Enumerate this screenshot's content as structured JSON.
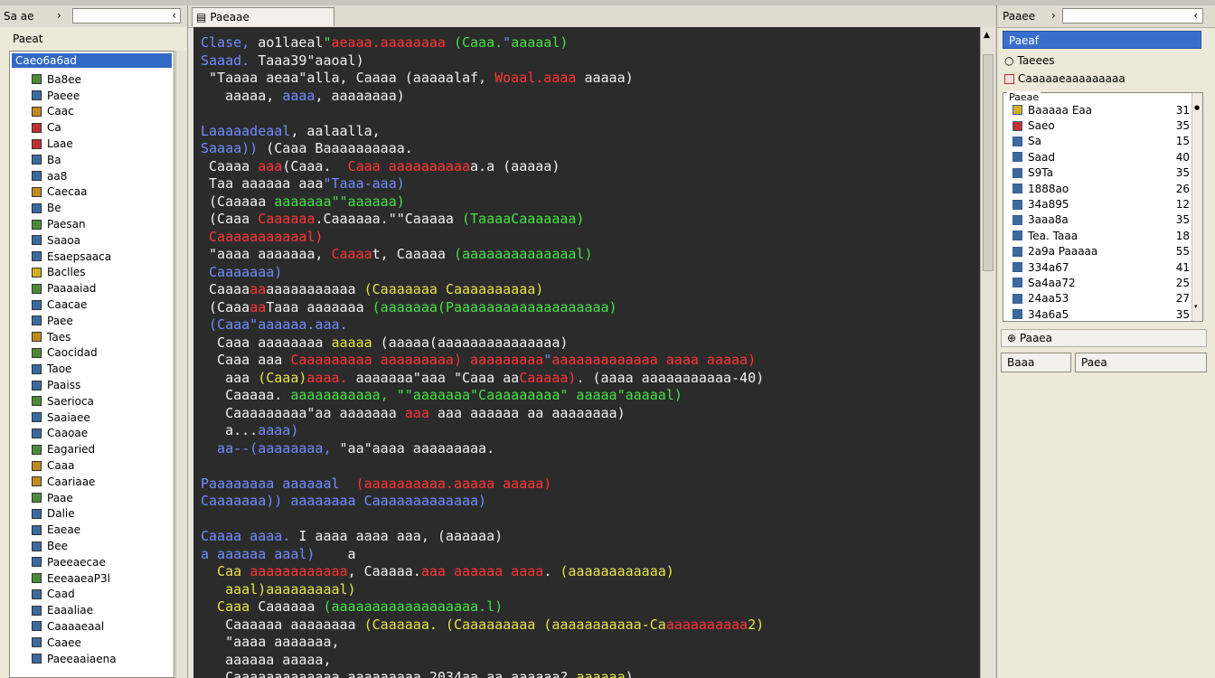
{
  "left": {
    "toolbar_label": "Sa ae",
    "toolbar_chev": "›",
    "toolbar_btn": "‹",
    "header": "Paeat",
    "root": "Caeo6a6ad",
    "items": [
      {
        "label": "Ba8ee",
        "color": "#4a8a3a"
      },
      {
        "label": "Paeee",
        "color": "#3a6aa0"
      },
      {
        "label": "Caac",
        "color": "#c08a20"
      },
      {
        "label": "Ca",
        "color": "#c03030"
      },
      {
        "label": "Laae",
        "color": "#c03030"
      },
      {
        "label": "Ba",
        "color": "#3a6aa0"
      },
      {
        "label": "aa8",
        "color": "#3a6aa0"
      },
      {
        "label": "Caecaa",
        "color": "#c08a20"
      },
      {
        "label": "Be",
        "color": "#3a6aa0"
      },
      {
        "label": "Paesan",
        "color": "#4a8a3a"
      },
      {
        "label": "Saaoa",
        "color": "#3a6aa0"
      },
      {
        "label": "Esaepsaaca",
        "color": "#3a6aa0"
      },
      {
        "label": "Baclles",
        "color": "#d0b020"
      },
      {
        "label": "Paaaaiad",
        "color": "#4a8a3a"
      },
      {
        "label": "Caacae",
        "color": "#3a6aa0"
      },
      {
        "label": "Paee",
        "color": "#3a6aa0"
      },
      {
        "label": "Taes",
        "color": "#c08a20"
      },
      {
        "label": "Caocidad",
        "color": "#4a8a3a"
      },
      {
        "label": "Taoe",
        "color": "#3a6aa0"
      },
      {
        "label": "Paaiss",
        "color": "#3a6aa0"
      },
      {
        "label": "Saerioca",
        "color": "#4a8a3a"
      },
      {
        "label": "Saaiaee",
        "color": "#3a6aa0"
      },
      {
        "label": "Caaoae",
        "color": "#3a6aa0"
      },
      {
        "label": "Eagaried",
        "color": "#4a8a3a"
      },
      {
        "label": "Caaa",
        "color": "#c08a20"
      },
      {
        "label": "Caariaae",
        "color": "#c08a20"
      },
      {
        "label": "Paae",
        "color": "#4a8a3a"
      },
      {
        "label": "Dalie",
        "color": "#3a6aa0"
      },
      {
        "label": "Eaeae",
        "color": "#3a6aa0"
      },
      {
        "label": "Bee",
        "color": "#3a6aa0"
      },
      {
        "label": "Paeeaecae",
        "color": "#3a6aa0"
      },
      {
        "label": "EeeaaeaP3l",
        "color": "#4a8a3a"
      },
      {
        "label": "Caad",
        "color": "#3a6aa0"
      },
      {
        "label": "Eaaaliae",
        "color": "#3a6aa0"
      },
      {
        "label": "Caaaaeaal",
        "color": "#3a6aa0"
      },
      {
        "label": "Caaee",
        "color": "#3a6aa0"
      },
      {
        "label": "Paeeaaiaena",
        "color": "#3a6aa0"
      }
    ]
  },
  "center": {
    "tab_label": "Paeaae"
  },
  "right": {
    "toolbar_label": "Paaee",
    "toolbar_chev": "›",
    "toolbar_btn": "‹",
    "selected": "Paeaf",
    "row1": "Taeees",
    "row2": "Caaaaaeaaaaaaaaa",
    "group_label": "Paeae",
    "items": [
      {
        "name": "Baaaaa Eaa",
        "value": "31",
        "color": "#d0b020"
      },
      {
        "name": "Saeo",
        "value": "35",
        "color": "#c03030"
      },
      {
        "name": "Sa",
        "value": "15",
        "color": "#3a6aa0"
      },
      {
        "name": "Saad",
        "value": "40",
        "color": "#3a6aa0"
      },
      {
        "name": "S9Ta",
        "value": "35",
        "color": "#3a6aa0"
      },
      {
        "name": "1888ao",
        "value": "26",
        "color": "#3a6aa0"
      },
      {
        "name": "34a895",
        "value": "12",
        "color": "#3a6aa0"
      },
      {
        "name": "3aaa8a",
        "value": "35",
        "color": "#3a6aa0"
      },
      {
        "name": "Tea. Taaa",
        "value": "18",
        "color": "#3a6aa0"
      },
      {
        "name": "2a9a Paaaaa",
        "value": "55",
        "color": "#3a6aa0"
      },
      {
        "name": "334a67",
        "value": "41",
        "color": "#3a6aa0"
      },
      {
        "name": "Sa4aa72",
        "value": "25",
        "color": "#3a6aa0"
      },
      {
        "name": "24aa53",
        "value": "27",
        "color": "#3a6aa0"
      },
      {
        "name": "34a6a5",
        "value": "35",
        "color": "#3a6aa0"
      }
    ],
    "section": "Paaea",
    "btn1": "Baaa",
    "btn2": "Paea"
  },
  "code_lines": [
    [
      {
        "c": "b",
        "t": "Clase, "
      },
      {
        "c": "w",
        "t": "ao1laeal"
      },
      {
        "c": "g",
        "t": "\""
      },
      {
        "c": "r",
        "t": "aeaaa.aaaaaaaa "
      },
      {
        "c": "g",
        "t": "(Caaa."
      },
      {
        "c": "b",
        "t": "\""
      },
      {
        "c": "g",
        "t": "aaaaal)"
      }
    ],
    [
      {
        "c": "b",
        "t": "Saaad. "
      },
      {
        "c": "w",
        "t": "Taaa39\"aaoal)"
      }
    ],
    [
      {
        "c": "w",
        "t": " \"Taaaa aeaa\"alla, Caaaa (aaaaalaf, "
      },
      {
        "c": "r",
        "t": "Woaal.aaaa"
      },
      {
        "c": "w",
        "t": " aaaaa)"
      }
    ],
    [
      {
        "c": "w",
        "t": "   aaaaa, "
      },
      {
        "c": "b",
        "t": "aaaa"
      },
      {
        "c": "w",
        "t": ", aaaaaaaa)"
      }
    ],
    [
      {
        "c": "w",
        "t": ""
      }
    ],
    [
      {
        "c": "b",
        "t": "Laaaaadeaal"
      },
      {
        "c": "w",
        "t": ", aalaalla,"
      }
    ],
    [
      {
        "c": "b",
        "t": "Saaaa)) "
      },
      {
        "c": "w",
        "t": "(Caaa Baaaaaaaaaa."
      }
    ],
    [
      {
        "c": "w",
        "t": " Caaaa "
      },
      {
        "c": "r",
        "t": "aaa"
      },
      {
        "c": "w",
        "t": "(Caaa.  "
      },
      {
        "c": "r",
        "t": "Caaa aaaaaaaaaa"
      },
      {
        "c": "w",
        "t": "a.a (aaaaa)"
      }
    ],
    [
      {
        "c": "w",
        "t": " Taa aaaaaa aaa"
      },
      {
        "c": "b",
        "t": "\"Taaa-aaa)"
      }
    ],
    [
      {
        "c": "w",
        "t": " (Caaaaa "
      },
      {
        "c": "g",
        "t": "aaaaaaa\"\"aaaaaa)"
      }
    ],
    [
      {
        "c": "w",
        "t": " (Caaa "
      },
      {
        "c": "r",
        "t": "Caaaaaa"
      },
      {
        "c": "w",
        "t": ".Caaaaaa.\"\"Caaaaa "
      },
      {
        "c": "g",
        "t": "(TaaaaCaaaaaaa)"
      }
    ],
    [
      {
        "c": "r",
        "t": " Caaaaaaaaaaal)"
      }
    ],
    [
      {
        "c": "w",
        "t": " \"aaaa aaaaaaa, "
      },
      {
        "c": "r",
        "t": "Caaaa"
      },
      {
        "c": "w",
        "t": "t, Caaaaa "
      },
      {
        "c": "g",
        "t": "(aaaaaaaaaaaaaal)"
      }
    ],
    [
      {
        "c": "b",
        "t": " Caaaaaaa)"
      }
    ],
    [
      {
        "c": "w",
        "t": " Caaaa"
      },
      {
        "c": "r",
        "t": "aa"
      },
      {
        "c": "w",
        "t": "aaaaaaaaaaa "
      },
      {
        "c": "y",
        "t": "(Caaaaaaa Caaaaaaaaaa)"
      }
    ],
    [
      {
        "c": "w",
        "t": " (Caaa"
      },
      {
        "c": "r",
        "t": "aa"
      },
      {
        "c": "w",
        "t": "Taaa aaaaaaa "
      },
      {
        "c": "g",
        "t": "(aaaaaaa(Paaaaaaaaaaaaaaaaaaa)"
      }
    ],
    [
      {
        "c": "b",
        "t": " (Caaa\"aaaaaa.aaa."
      }
    ],
    [
      {
        "c": "w",
        "t": "  Caaa aaaaaaaa "
      },
      {
        "c": "y",
        "t": "aaaaa"
      },
      {
        "c": "w",
        "t": " (aaaaa(aaaaaaaaaaaaaaa)"
      }
    ],
    [
      {
        "c": "w",
        "t": "  Caaa aaa "
      },
      {
        "c": "r",
        "t": "Caaaaaaaaa aaaaaaaaa) aaaaaaaaa"
      },
      {
        "c": "b",
        "t": "\""
      },
      {
        "c": "r",
        "t": "aaaaaaaaaaaaa aaaa aaaaa)"
      }
    ],
    [
      {
        "c": "w",
        "t": "   aaa "
      },
      {
        "c": "y",
        "t": "(Caaa)"
      },
      {
        "c": "r",
        "t": "aaaa."
      },
      {
        "c": "w",
        "t": " aaaaaaa\"aaa \"Caaa aa"
      },
      {
        "c": "r",
        "t": "Caaaaa)"
      },
      {
        "c": "w",
        "t": ". (aaaa aaaaaaaaaaa-40)"
      }
    ],
    [
      {
        "c": "w",
        "t": "   Caaaaa. "
      },
      {
        "c": "g",
        "t": "aaaaaaaaaaa, \"\"aaaaaaa\"Caaaaaaaaa\" aaaaa\"aaaaal)"
      }
    ],
    [
      {
        "c": "w",
        "t": "   Caaaaaaaaa\"aa aaaaaaa "
      },
      {
        "c": "r",
        "t": "aaa"
      },
      {
        "c": "w",
        "t": " aaa aaaaaa aa aaaaaaaa)"
      }
    ],
    [
      {
        "c": "w",
        "t": "   a..."
      },
      {
        "c": "b",
        "t": "aaaa)"
      }
    ],
    [
      {
        "c": "b",
        "t": "  aa--(aaaaaaaa, "
      },
      {
        "c": "w",
        "t": "\"aa\"aaaa aaaaaaaaa."
      }
    ],
    [
      {
        "c": "w",
        "t": ""
      }
    ],
    [
      {
        "c": "b",
        "t": "Paaaaaaaa aaaaaal  "
      },
      {
        "c": "r",
        "t": "(aaaaaaaaaa.aaaaa aaaaa)"
      }
    ],
    [
      {
        "c": "b",
        "t": "Caaaaaaa)) "
      },
      {
        "c": "b",
        "t": "aaaaaaaa Caaaaaaaaaaaaa)"
      }
    ],
    [
      {
        "c": "w",
        "t": ""
      }
    ],
    [
      {
        "c": "b",
        "t": "Caaaa aaaa. "
      },
      {
        "c": "w",
        "t": "I aaaa aaaa aaa, (aaaaaa)"
      }
    ],
    [
      {
        "c": "b",
        "t": "a aaaaaa aaal)"
      },
      {
        "c": "w",
        "t": "    a"
      }
    ],
    [
      {
        "c": "y",
        "t": "  Caa "
      },
      {
        "c": "r",
        "t": "aaaaaaaaaaaa"
      },
      {
        "c": "w",
        "t": ", Caaaaa."
      },
      {
        "c": "r",
        "t": "aaa aaaaaa aaaa"
      },
      {
        "c": "w",
        "t": ". "
      },
      {
        "c": "y",
        "t": "(aaaaaaaaaaaa)"
      }
    ],
    [
      {
        "c": "y",
        "t": "   aaal)aaaaaaaaal)"
      }
    ],
    [
      {
        "c": "y",
        "t": "  Caaa "
      },
      {
        "c": "w",
        "t": "Caaaaaa "
      },
      {
        "c": "g",
        "t": "(aaaaaaaaaaaaaaaaaa.l)"
      }
    ],
    [
      {
        "c": "w",
        "t": "   Caaaaaa aaaaaaaa "
      },
      {
        "c": "y",
        "t": "(Caaaaaa. (Caaaaaaaaa (aaaaaaaaaaa-Ca"
      },
      {
        "c": "r",
        "t": "aaaaaaaaaa"
      },
      {
        "c": "y",
        "t": "2)"
      }
    ],
    [
      {
        "c": "w",
        "t": "   \"aaaa aaaaaaa,"
      }
    ],
    [
      {
        "c": "w",
        "t": "   aaaaaa aaaaa,"
      }
    ],
    [
      {
        "c": "w",
        "t": "   Caaaaaaaaaaaaa aaaaaaaaa 2034aa aa aaaaaa? "
      },
      {
        "c": "y",
        "t": "aaaaaa"
      },
      {
        "c": "w",
        "t": "),"
      }
    ]
  ]
}
